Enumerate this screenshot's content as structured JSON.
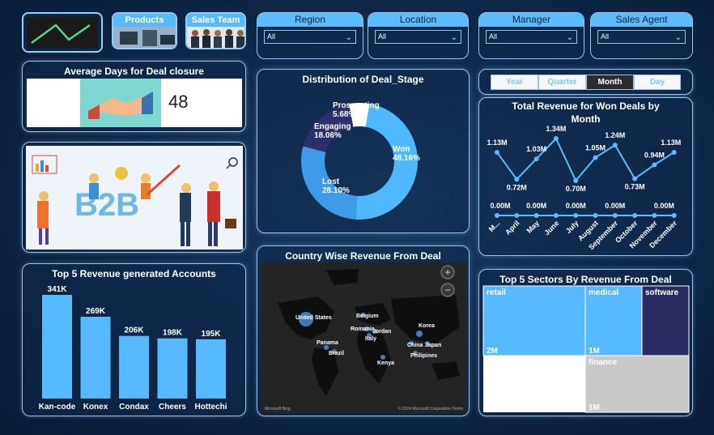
{
  "nav": {
    "products_label": "Products",
    "sales_team_label": "Sales Team"
  },
  "slicers": [
    {
      "id": "region",
      "title": "Region",
      "value": "All"
    },
    {
      "id": "location",
      "title": "Location",
      "value": "All"
    },
    {
      "id": "manager",
      "title": "Manager",
      "value": "All"
    },
    {
      "id": "agent",
      "title": "Sales Agent",
      "value": "All"
    }
  ],
  "avg_days": {
    "title": "Average Days for Deal closure",
    "value": "48"
  },
  "b2b_text": "B2B",
  "period_tabs": {
    "items": [
      "Year",
      "Quarter",
      "Month",
      "Day"
    ],
    "active": "Month"
  },
  "deal_stage": {
    "title": "Distribution of Deal_Stage",
    "chart_data": {
      "type": "pie",
      "variant": "donut",
      "labels": [
        "Won",
        "Lost",
        "Engaging",
        "Prospecting"
      ],
      "values": [
        48.16,
        28.1,
        18.06,
        5.68
      ],
      "display": [
        "48.16%",
        "28.10%",
        "18.06%",
        "5.68%"
      ],
      "colors": [
        "#4fb8ff",
        "#3e9be8",
        "#2b2f6b",
        "#ffffff"
      ]
    }
  },
  "revenue_month": {
    "title_line1": "Total Revenue for Won Deals by",
    "title_line2": "Month",
    "chart_data": {
      "type": "line",
      "categories": [
        "M...",
        "April",
        "May",
        "June",
        "July",
        "August",
        "September",
        "October",
        "November",
        "December"
      ],
      "series": [
        {
          "values": [
            1.13,
            0.72,
            1.03,
            1.34,
            0.7,
            1.05,
            1.24,
            0.73,
            0.94,
            1.13
          ],
          "labels": [
            "1.13M",
            "0.72M",
            "1.03M",
            "1.34M",
            "0.70M",
            "1.05M",
            "1.24M",
            "0.73M",
            "0.94M",
            "1.13M"
          ]
        },
        {
          "values": [
            0,
            0,
            0,
            0,
            0,
            0,
            0,
            0,
            0,
            0
          ],
          "labels": [
            "0.00M",
            "0.00M",
            "0.00M",
            "0.00M",
            "0.00M",
            "0.00M",
            "0.00M",
            "0.00M",
            "0.00M",
            "0.00M"
          ]
        }
      ]
    }
  },
  "top_accounts": {
    "title": "Top 5 Revenue generated Accounts",
    "chart_data": {
      "type": "bar",
      "categories": [
        "Kan-code",
        "Konex",
        "Condax",
        "Cheers",
        "Hottechi"
      ],
      "values": [
        341,
        269,
        206,
        198,
        195
      ],
      "labels": [
        "341K",
        "269K",
        "206K",
        "198K",
        "195K"
      ],
      "color": "#57b9ff"
    }
  },
  "country_map": {
    "title": "Country Wise Revenue From Deal",
    "zoom_in": "+",
    "zoom_out": "−",
    "countries": [
      "United States",
      "Panama",
      "Brazil",
      "Belgium",
      "Romania",
      "Jordan",
      "Italy",
      "Kenya",
      "Korea",
      "China",
      "Japan",
      "Philipines"
    ],
    "footer_left": "Microsoft Bing",
    "footer_right": "© 2024 Microsoft Corporation  Terms"
  },
  "top_sectors": {
    "title": "Top 5 Sectors By Revenue From Deal",
    "chart_data": {
      "type": "treemap",
      "labels": [
        "retail",
        "medical",
        "software",
        "finance"
      ],
      "values": [
        "2M",
        "1M",
        "1M",
        "1M"
      ],
      "colors": [
        "#57b9ff",
        "#57b9ff",
        "#2a2b63",
        "#c9c9c9"
      ]
    }
  }
}
